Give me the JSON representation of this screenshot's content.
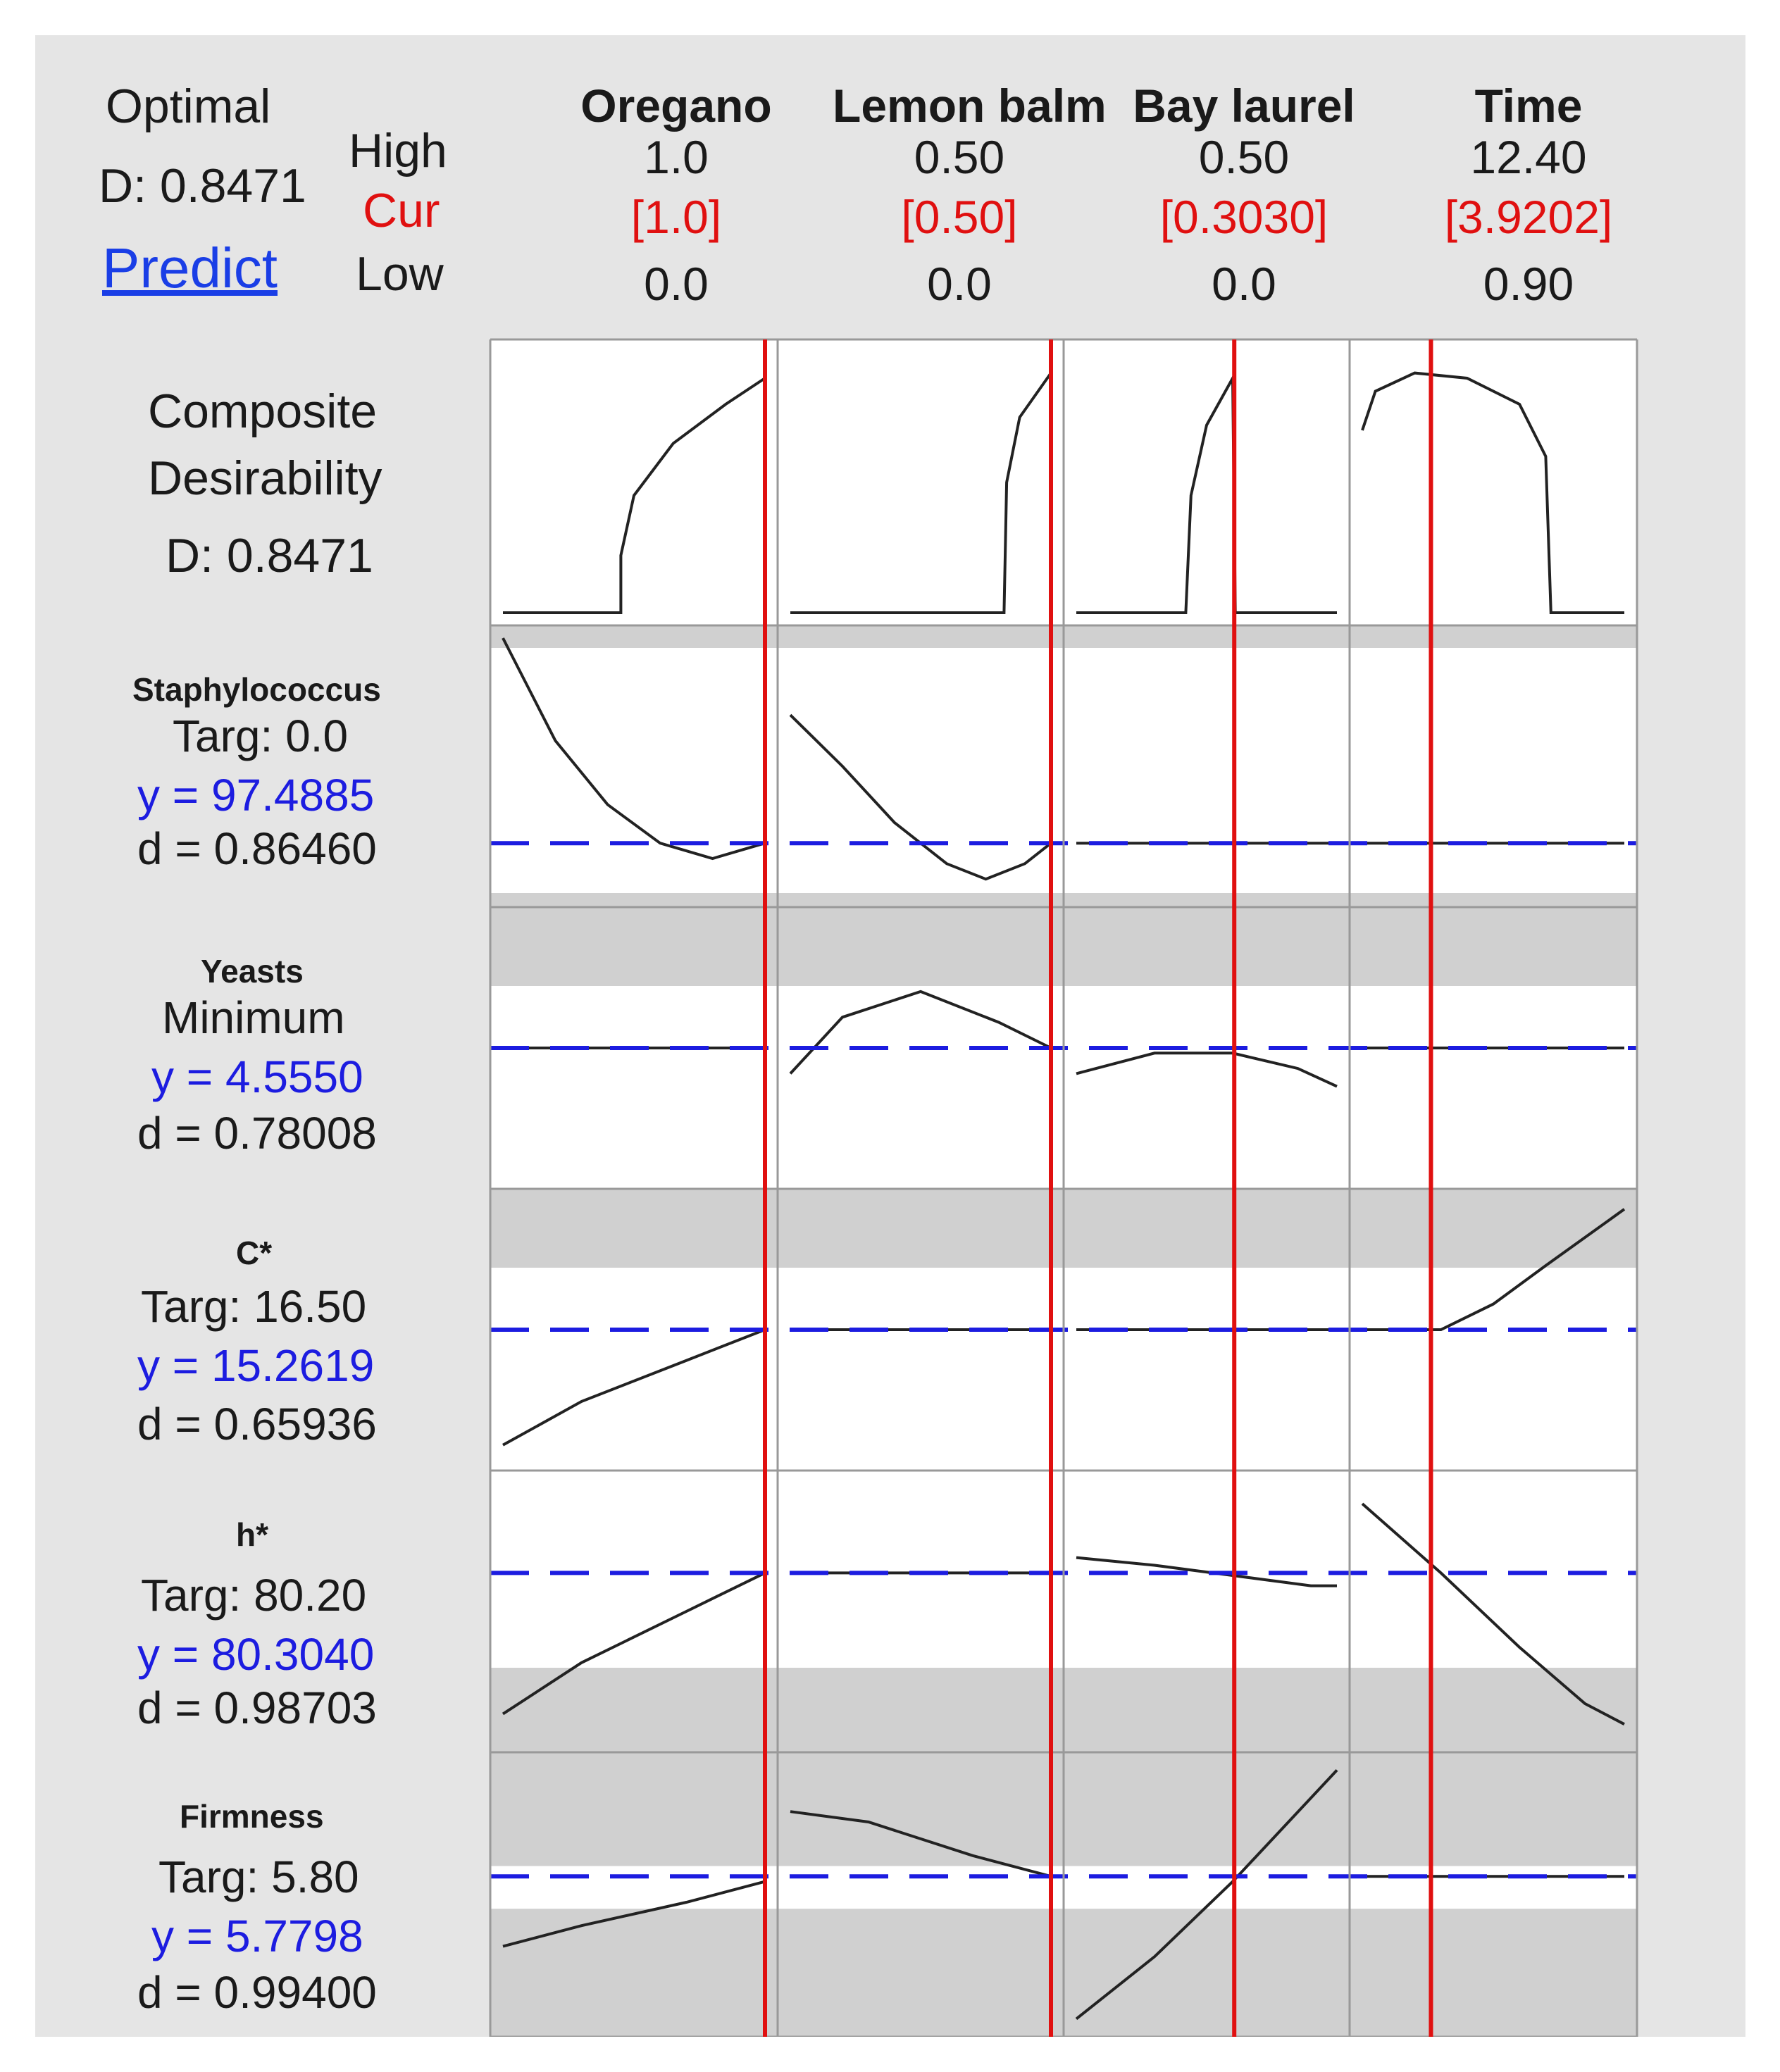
{
  "header": {
    "optimal_label": "Optimal",
    "d_value": "D: 0.8471",
    "predict_link": "Predict",
    "high_label": "High",
    "cur_label": "Cur",
    "low_label": "Low"
  },
  "factors": [
    {
      "name": "Oregano",
      "high": "1.0",
      "cur": "[1.0]",
      "low": "0.0"
    },
    {
      "name": "Lemon balm",
      "high": "0.50",
      "cur": "[0.50]",
      "low": "0.0"
    },
    {
      "name": "Bay laurel",
      "high": "0.50",
      "cur": "[0.3030]",
      "low": "0.0"
    },
    {
      "name": "Time",
      "high": "12.40",
      "cur": "[3.9202]",
      "low": "0.90"
    }
  ],
  "composite": {
    "line1": "Composite",
    "line2": "Desirability",
    "d_value": "D: 0.8471"
  },
  "responses": [
    {
      "name": "Staphylococcus",
      "goal": "Targ: 0.0",
      "y": "y = 97.4885",
      "d": "d = 0.86460"
    },
    {
      "name": "Yeasts",
      "goal": "Minimum",
      "y": "y = 4.5550",
      "d": "d = 0.78008"
    },
    {
      "name": "C*",
      "goal": "Targ: 16.50",
      "y": "y = 15.2619",
      "d": "d = 0.65936"
    },
    {
      "name": "h*",
      "goal": "Targ: 80.20",
      "y": "y = 80.3040",
      "d": "d = 0.98703"
    },
    {
      "name": "Firmness",
      "goal": "Targ: 5.80",
      "y": "y = 5.7798",
      "d": "d = 0.99400"
    }
  ],
  "colors": {
    "current_setting_line": "#e01010",
    "predicted_value_line": "#1c1ce0",
    "undesirable_band": "#d0d0d0",
    "panel_background": "#e5e5e5"
  },
  "profiles": {
    "composite": [
      [
        [
          0,
          0
        ],
        [
          0.45,
          0
        ],
        [
          0.45,
          0.22
        ],
        [
          0.5,
          0.45
        ],
        [
          0.65,
          0.65
        ],
        [
          0.85,
          0.8
        ],
        [
          1,
          0.9
        ]
      ],
      [
        [
          0,
          0
        ],
        [
          0.82,
          0
        ],
        [
          0.83,
          0.5
        ],
        [
          0.88,
          0.75
        ],
        [
          1,
          0.92
        ]
      ],
      [
        [
          0,
          0
        ],
        [
          0.42,
          0
        ],
        [
          0.44,
          0.45
        ],
        [
          0.5,
          0.72
        ],
        [
          0.6,
          0.9
        ],
        [
          0.61,
          0
        ],
        [
          1,
          0
        ]
      ],
      [
        [
          0,
          0.7
        ],
        [
          0.05,
          0.85
        ],
        [
          0.2,
          0.92
        ],
        [
          0.4,
          0.9
        ],
        [
          0.6,
          0.8
        ],
        [
          0.7,
          0.6
        ],
        [
          0.72,
          0
        ],
        [
          1,
          0
        ]
      ]
    ],
    "staphylococcus": [
      [
        [
          0,
          1.0
        ],
        [
          0.2,
          0.6
        ],
        [
          0.4,
          0.35
        ],
        [
          0.6,
          0.2
        ],
        [
          0.8,
          0.14
        ],
        [
          1,
          0.2
        ]
      ],
      [
        [
          0,
          0.7
        ],
        [
          0.2,
          0.5
        ],
        [
          0.4,
          0.28
        ],
        [
          0.6,
          0.12
        ],
        [
          0.75,
          0.06
        ],
        [
          0.9,
          0.12
        ],
        [
          1,
          0.2
        ]
      ],
      [
        [
          0,
          0.2
        ],
        [
          1,
          0.2
        ]
      ],
      [
        [
          0,
          0.2
        ],
        [
          1,
          0.2
        ]
      ]
    ],
    "yeasts": [
      [
        [
          0,
          0.5
        ],
        [
          1,
          0.5
        ]
      ],
      [
        [
          0,
          0.4
        ],
        [
          0.2,
          0.62
        ],
        [
          0.5,
          0.72
        ],
        [
          0.8,
          0.6
        ],
        [
          1,
          0.5
        ]
      ],
      [
        [
          0,
          0.4
        ],
        [
          0.3,
          0.48
        ],
        [
          0.6,
          0.48
        ],
        [
          0.85,
          0.42
        ],
        [
          1,
          0.35
        ]
      ],
      [
        [
          0,
          0.5
        ],
        [
          1,
          0.5
        ]
      ]
    ],
    "cstar": [
      [
        [
          0,
          0.05
        ],
        [
          0.3,
          0.22
        ],
        [
          0.7,
          0.38
        ],
        [
          1,
          0.5
        ]
      ],
      [
        [
          0,
          0.5
        ],
        [
          1,
          0.5
        ]
      ],
      [
        [
          0,
          0.5
        ],
        [
          1,
          0.5
        ]
      ],
      [
        [
          0,
          0.5
        ],
        [
          0.3,
          0.5
        ],
        [
          0.5,
          0.6
        ],
        [
          0.7,
          0.75
        ],
        [
          1,
          0.97
        ]
      ]
    ],
    "hstar": [
      [
        [
          0,
          0.1
        ],
        [
          0.3,
          0.3
        ],
        [
          0.7,
          0.5
        ],
        [
          1,
          0.65
        ]
      ],
      [
        [
          0,
          0.65
        ],
        [
          1,
          0.65
        ]
      ],
      [
        [
          0,
          0.71
        ],
        [
          0.3,
          0.68
        ],
        [
          0.6,
          0.64
        ],
        [
          0.9,
          0.6
        ],
        [
          1,
          0.6
        ]
      ],
      [
        [
          0,
          0.92
        ],
        [
          0.3,
          0.65
        ],
        [
          0.6,
          0.36
        ],
        [
          0.85,
          0.14
        ],
        [
          1,
          0.06
        ]
      ]
    ],
    "firmness": [
      [
        [
          0,
          0.3
        ],
        [
          0.3,
          0.38
        ],
        [
          0.7,
          0.47
        ],
        [
          1,
          0.55
        ]
      ],
      [
        [
          0,
          0.82
        ],
        [
          0.3,
          0.78
        ],
        [
          0.7,
          0.65
        ],
        [
          1,
          0.57
        ]
      ],
      [
        [
          0,
          0.02
        ],
        [
          0.3,
          0.26
        ],
        [
          0.6,
          0.55
        ],
        [
          1,
          0.98
        ]
      ],
      [
        [
          0,
          0.57
        ],
        [
          1,
          0.57
        ]
      ]
    ]
  },
  "bands": {
    "staphylococcus": [
      [
        0.0,
        0.05
      ],
      [
        0.92,
        1.0
      ]
    ],
    "yeasts": [
      [
        0.72,
        1.0
      ]
    ],
    "cstar": [
      [
        0.72,
        1.0
      ]
    ],
    "hstar": [
      [
        0.0,
        0.3
      ]
    ],
    "firmness": [
      [
        0.0,
        0.45
      ],
      [
        0.6,
        1.0
      ]
    ]
  },
  "predicted_levels": {
    "staphylococcus": 0.2,
    "yeasts": 0.5,
    "cstar": 0.5,
    "hstar": 0.65,
    "firmness": 0.57
  },
  "current_settings_fraction": [
    1.0,
    1.0,
    0.606,
    0.262
  ]
}
